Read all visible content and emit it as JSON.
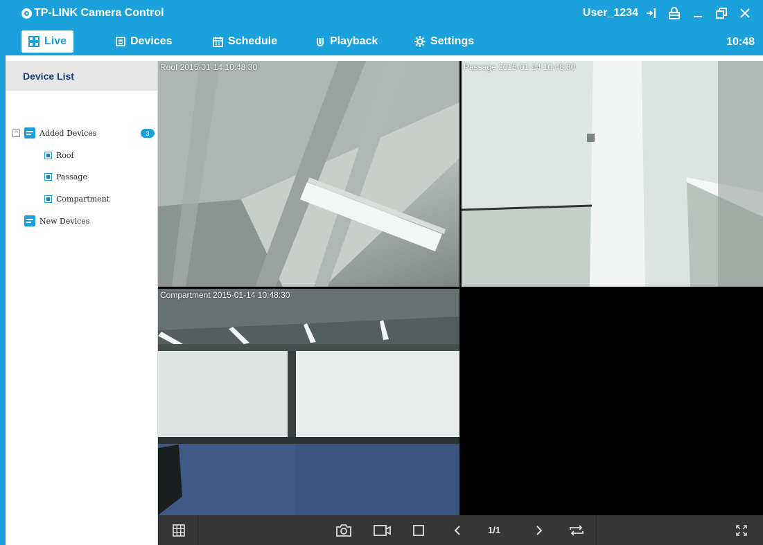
{
  "window": {
    "title": "TP-LINK Camera Control",
    "username": "User_1234",
    "accent_color": "#1aa0db",
    "icons": [
      "logout-icon",
      "lock-icon",
      "minimize-icon",
      "restore-icon",
      "close-icon"
    ]
  },
  "tabs": [
    {
      "label": "Live",
      "icon": "grid-icon",
      "active": true
    },
    {
      "label": "Devices",
      "icon": "device-list-icon",
      "active": false
    },
    {
      "label": "Schedule",
      "icon": "calendar-icon",
      "active": false
    },
    {
      "label": "Playback",
      "icon": "playback-icon",
      "active": false
    },
    {
      "label": "Settings",
      "icon": "gear-icon",
      "active": false
    }
  ],
  "clock": "10:48",
  "sidebar": {
    "title": "Device List",
    "groups": [
      {
        "label": "Added Devices",
        "count": "3",
        "expanded": true,
        "expander": "−",
        "devices": [
          {
            "label": "Roof"
          },
          {
            "label": "Passage"
          },
          {
            "label": "Compartment"
          }
        ]
      },
      {
        "label": "New Devices",
        "devices": []
      }
    ]
  },
  "video": {
    "tiles": [
      {
        "camera": "Roof",
        "timestamp": "2015-01-14 10:48:30"
      },
      {
        "camera": "Passage",
        "timestamp": "2015-01-14 10:48:30"
      },
      {
        "camera": "Compartment",
        "timestamp": "2015-01-14 10:48:30"
      },
      {
        "camera": "",
        "timestamp": ""
      }
    ]
  },
  "toolbar": {
    "page_indicator": "1/1",
    "icons": [
      "layout-grid-icon",
      "snapshot-icon",
      "record-icon",
      "stop-icon",
      "prev-page-icon",
      "next-page-icon",
      "cycle-icon",
      "fullscreen-icon"
    ]
  }
}
